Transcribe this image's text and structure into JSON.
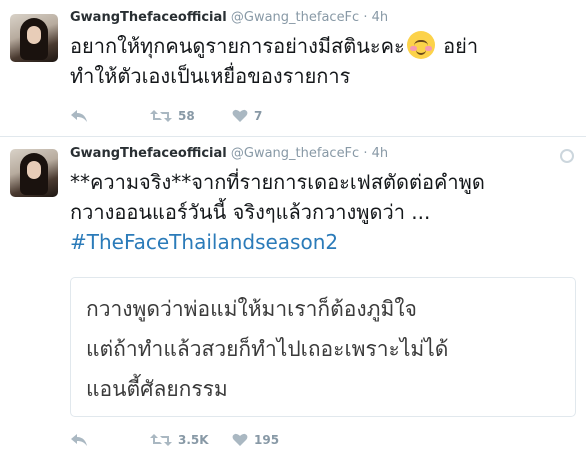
{
  "tweets": [
    {
      "name": "GwangThefaceofficial",
      "handle": "@Gwang_thefaceFc",
      "separator": "·",
      "time": "4h",
      "text_line1_a": "อยากให้ทุกคนดูรายการอย่างมีสตินะคะ",
      "text_line1_b": "อย่า",
      "text_line2": "ทำให้ตัวเองเป็นเหยื่อของรายการ",
      "emoji": "smiling-face-with-blush-icon",
      "retweets": "58",
      "likes": "7"
    },
    {
      "name": "GwangThefaceofficial",
      "handle": "@Gwang_thefaceFc",
      "separator": "·",
      "time": "4h",
      "text_line1": "**ความจริง**จากที่รายการเดอะเฟสตัดต่อคำพูด",
      "text_line2": "กวางออนแอร์วันนี้ จริงๆแล้วกวางพูดว่า ...",
      "hashtag": "#TheFaceThailandseason2",
      "card_line1": "กวางพูดว่าพ่อแม่ให้มาเราก็ต้องภูมิใจ",
      "card_line2": "แต่ถ้าทำแล้วสวยก็ทำไปเถอะเพราะไม่ได้",
      "card_line3": "แอนตี้ศัลยกรรม",
      "retweets": "3.5K",
      "likes": "195"
    }
  ],
  "colors": {
    "link": "#2b7bb9",
    "meta": "#8899a6",
    "text": "#14171a",
    "border": "#e1e8ed"
  }
}
